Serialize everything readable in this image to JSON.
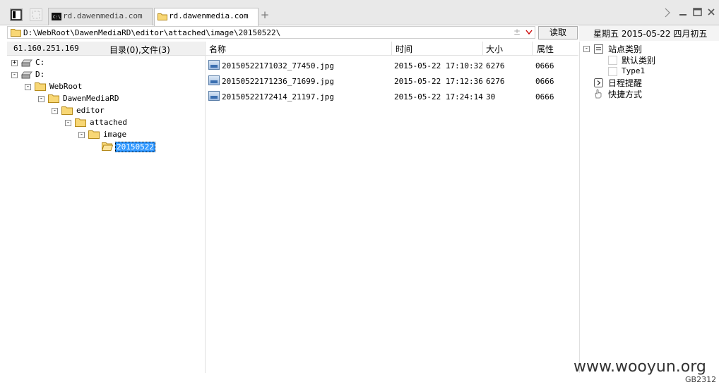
{
  "tabs": [
    {
      "label": "rd.dawenmedia.com",
      "icon": "terminal-icon",
      "active": false
    },
    {
      "label": "rd.dawenmedia.com",
      "icon": "folder-icon",
      "active": true
    }
  ],
  "new_tab_label": "+",
  "address": {
    "path": "D:\\WebRoot\\DawenMediaRD\\editor\\attached\\image\\20150522\\"
  },
  "read_button": "读取",
  "date_display": "星期五 2015-05-22 四月初五",
  "left_pane": {
    "ip": "61.160.251.169",
    "count": "目录(0),文件(3)"
  },
  "tree": [
    {
      "label": "C:",
      "toggle": "+"
    },
    {
      "label": "D:",
      "toggle": "-"
    },
    {
      "label": "WebRoot",
      "toggle": "-"
    },
    {
      "label": "DawenMediaRD",
      "toggle": "-"
    },
    {
      "label": "editor",
      "toggle": "-"
    },
    {
      "label": "attached",
      "toggle": "-"
    },
    {
      "label": "image",
      "toggle": "-"
    },
    {
      "label": "20150522",
      "toggle": "",
      "selected": true
    }
  ],
  "file_list": {
    "columns": {
      "name": "名称",
      "time": "时间",
      "size": "大小",
      "attr": "属性"
    },
    "rows": [
      {
        "name": "20150522171032_77450.jpg",
        "time": "2015-05-22 17:10:32",
        "size": "6276",
        "attr": "0666"
      },
      {
        "name": "20150522171236_71699.jpg",
        "time": "2015-05-22 17:12:36",
        "size": "6276",
        "attr": "0666"
      },
      {
        "name": "20150522172414_21197.jpg",
        "time": "2015-05-22 17:24:14",
        "size": "30",
        "attr": "0666"
      }
    ]
  },
  "right_panel": {
    "site_category": "站点类别",
    "default_category": "默认类别",
    "type1": "Type1",
    "schedule": "日程提醒",
    "shortcuts": "快捷方式"
  },
  "watermark": "www.wooyun.org",
  "encoding": "GB2312",
  "colors": {
    "selection": "#3399ff",
    "folder": "#f5c542"
  }
}
